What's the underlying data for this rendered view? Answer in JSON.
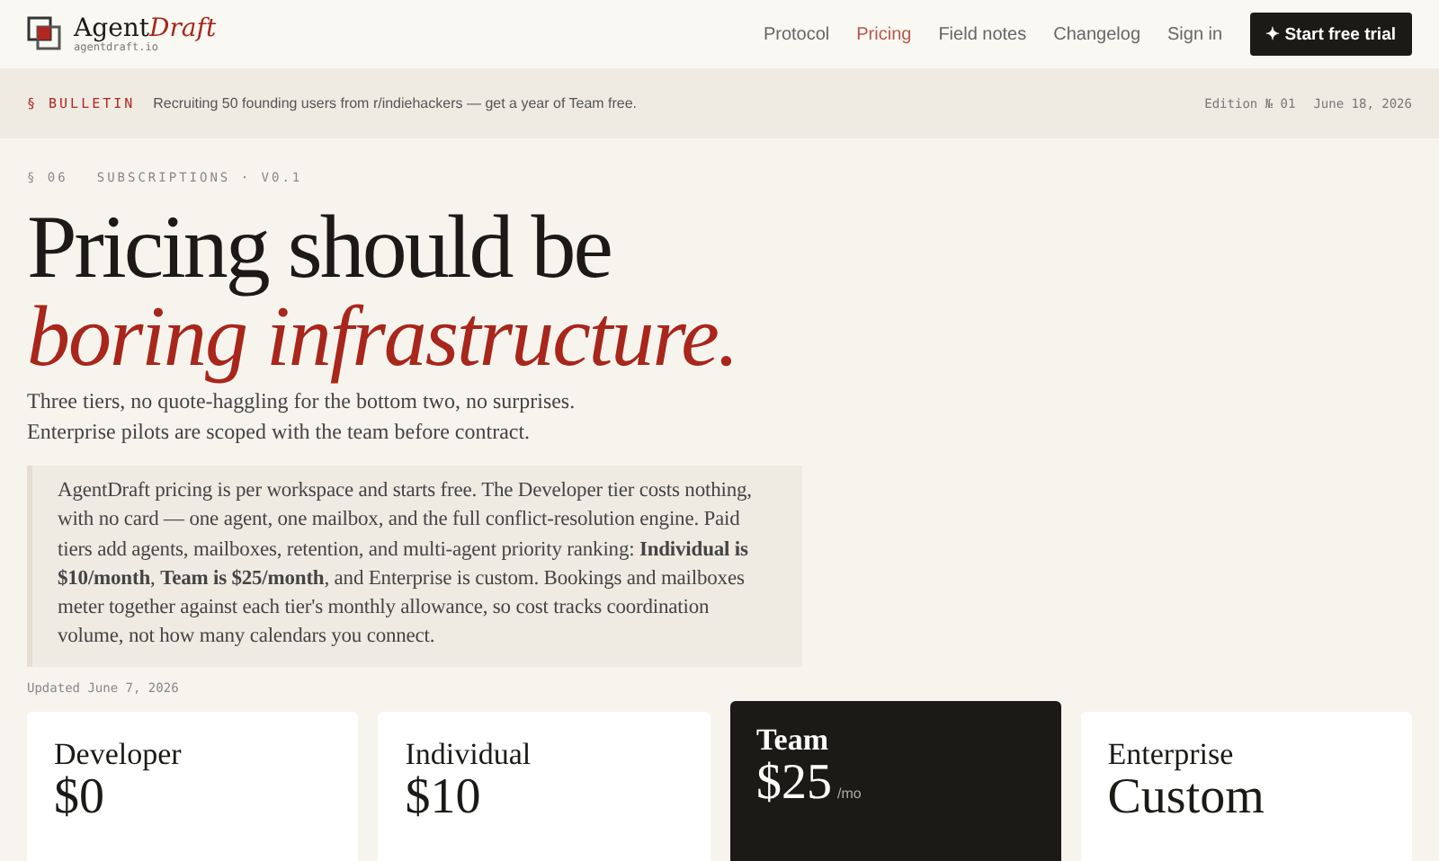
{
  "brand": {
    "name": "Agent",
    "name_accent": "Draft",
    "domain": "agentdraft.io"
  },
  "nav": [
    {
      "label": "Protocol",
      "selected": false
    },
    {
      "label": "Pricing",
      "selected": true
    },
    {
      "label": "Field notes",
      "selected": false
    },
    {
      "label": "Changelog",
      "selected": false
    },
    {
      "label": "Sign in",
      "selected": false
    }
  ],
  "cta": {
    "icon": "✦",
    "label": "Start free trial"
  },
  "bulletin": {
    "tag": "§ BULLETIN",
    "text": "Recruiting 50 founding users from r/indiehackers — get a year of Team free.",
    "edition": "Edition № 01",
    "date": "June 18, 2026"
  },
  "eyebrow": {
    "section": "§ 06",
    "label": "SUBSCRIPTIONS · V0.1"
  },
  "headline": {
    "line_1": "Pricing should be",
    "line_2": "boring infrastructure."
  },
  "subtitle": [
    "Three tiers, no quote-haggling for the bottom two, no surprises.",
    "Enterprise pilots are scoped with the team before contract."
  ],
  "summary": "AgentDraft pricing is per workspace and starts free. The Developer tier costs nothing, with no card — one agent, one mailbox, and the full conflict-resolution engine. Paid tiers add agents, mailboxes, retention, and multi-agent priority ranking: **Individual is $10/month**, **Team is $25/month**, and Enterprise is custom. Bookings and mailboxes meter together against each tier's monthly allowance, so cost tracks coordination volume, not how many calendars you connect.",
  "updated": "Updated June 7, 2026",
  "tiers": [
    {
      "name": "Developer",
      "price": "$0",
      "featured": false
    },
    {
      "name": "Individual",
      "price": "$10",
      "featured": false
    },
    {
      "name": "Team",
      "price": "$25",
      "unit": "/mo",
      "featured": true
    },
    {
      "name": "Enterprise",
      "price": "Custom",
      "featured": false
    }
  ]
}
